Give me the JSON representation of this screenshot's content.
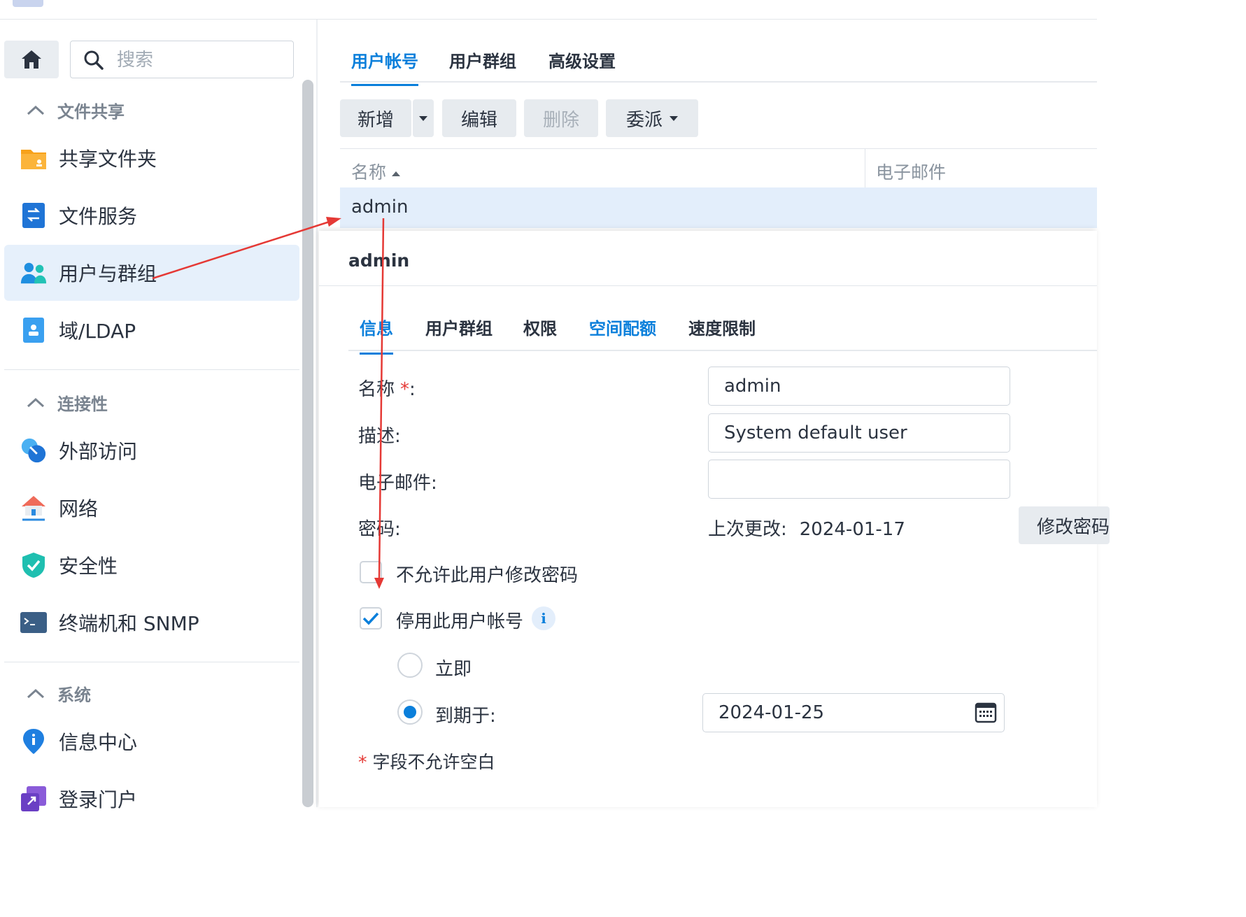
{
  "sidebar": {
    "search_placeholder": "搜索",
    "sections": {
      "file_sharing": "文件共享",
      "connectivity": "连接性",
      "system": "系统"
    },
    "items": {
      "shared_folder": "共享文件夹",
      "file_services": "文件服务",
      "users_groups": "用户与群组",
      "domain_ldap": "域/LDAP",
      "external_access": "外部访问",
      "network": "网络",
      "security": "安全性",
      "terminal_snmp": "终端机和 SNMP",
      "info_center": "信息中心",
      "login_portal": "登录门户"
    }
  },
  "main": {
    "tabs": [
      "用户帐号",
      "用户群组",
      "高级设置"
    ],
    "toolbar": {
      "add": "新增",
      "edit": "编辑",
      "delete": "删除",
      "delegate": "委派"
    },
    "grid": {
      "col_name": "名称",
      "col_email": "电子邮件",
      "row_name": "admin"
    }
  },
  "detail": {
    "title": "admin",
    "tabs": [
      "信息",
      "用户群组",
      "权限",
      "空间配额",
      "速度限制"
    ],
    "labels": {
      "name": "名称",
      "required_mark": "*",
      "name_colon": ":",
      "description": "描述:",
      "email": "电子邮件:",
      "password": "密码:"
    },
    "values": {
      "name": "admin",
      "description": "System default user",
      "email": ""
    },
    "password_last_changed_label": "上次更改:",
    "password_last_changed": "2024-01-17",
    "change_password_button": "修改密码",
    "checkbox_disallow_change": "不允许此用户修改密码",
    "checkbox_disable_account": "停用此用户帐号",
    "radio_immediately": "立即",
    "radio_expire_on": "到期于:",
    "expire_date": "2024-01-25",
    "footnote": "字段不允许空白"
  }
}
